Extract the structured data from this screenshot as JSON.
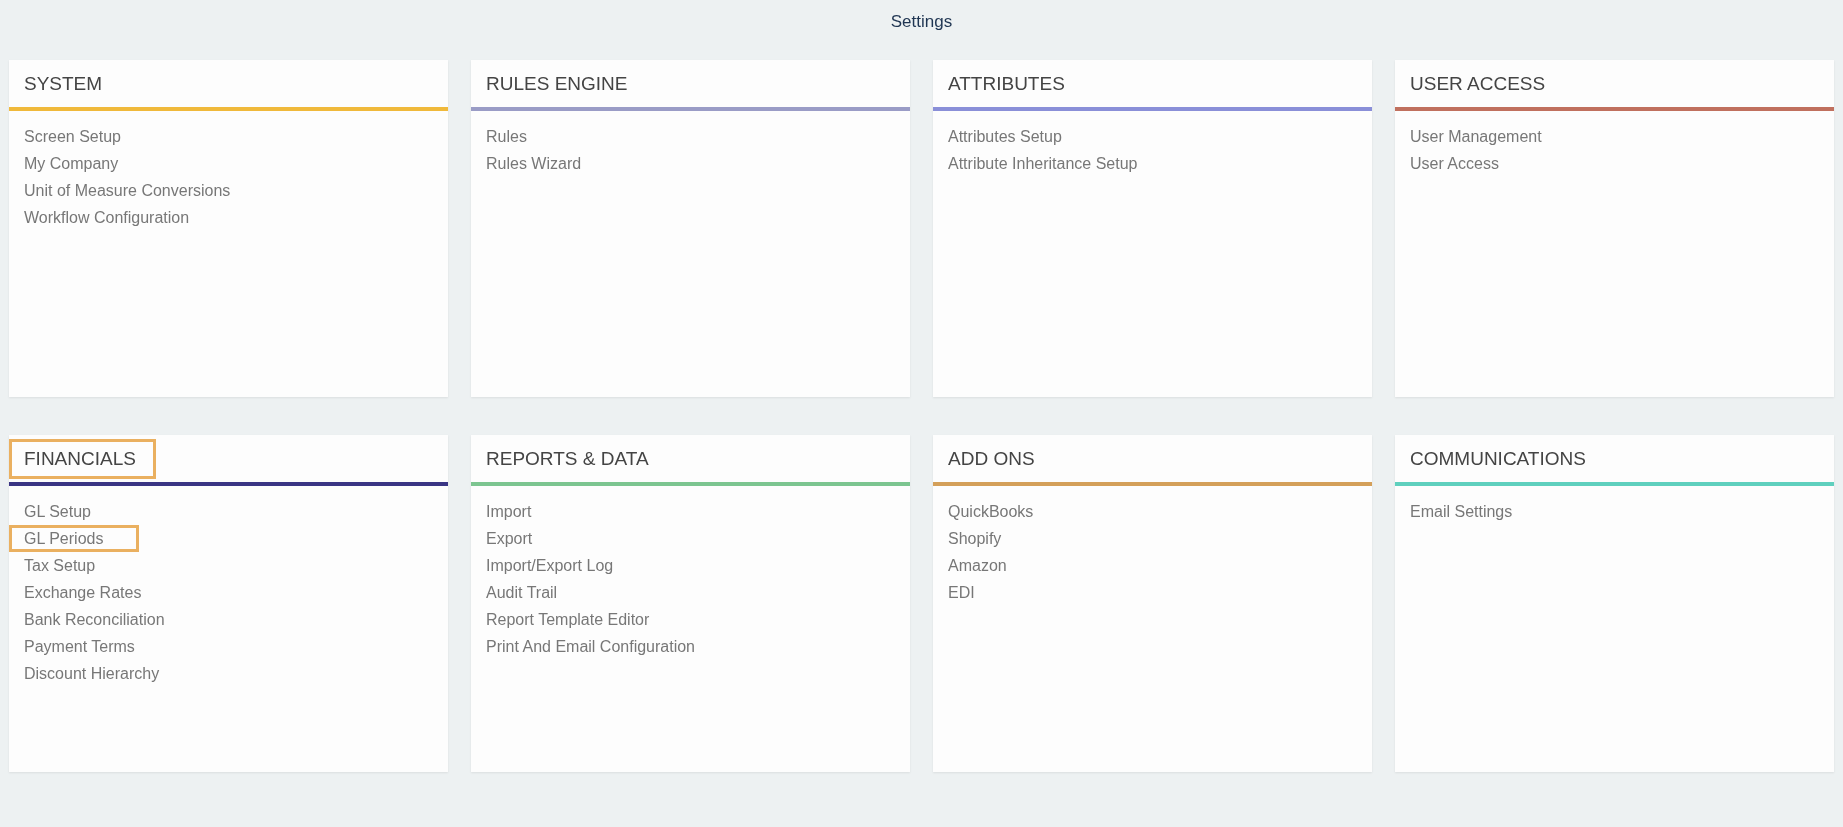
{
  "page": {
    "title": "Settings"
  },
  "sections": [
    {
      "title": "SYSTEM",
      "color": "#f0b93b",
      "highlighted": false,
      "items": [
        {
          "label": "Screen Setup",
          "highlighted": false
        },
        {
          "label": "My Company",
          "highlighted": false
        },
        {
          "label": "Unit of Measure Conversions",
          "highlighted": false
        },
        {
          "label": "Workflow Configuration",
          "highlighted": false
        }
      ]
    },
    {
      "title": "RULES ENGINE",
      "color": "#9a9cc6",
      "highlighted": false,
      "items": [
        {
          "label": "Rules",
          "highlighted": false
        },
        {
          "label": "Rules Wizard",
          "highlighted": false
        }
      ]
    },
    {
      "title": "ATTRIBUTES",
      "color": "#8a8fd8",
      "highlighted": false,
      "items": [
        {
          "label": "Attributes Setup",
          "highlighted": false
        },
        {
          "label": "Attribute Inheritance Setup",
          "highlighted": false
        }
      ]
    },
    {
      "title": "USER ACCESS",
      "color": "#c0705e",
      "highlighted": false,
      "items": [
        {
          "label": "User Management",
          "highlighted": false
        },
        {
          "label": "User Access",
          "highlighted": false
        }
      ]
    },
    {
      "title": "FINANCIALS",
      "color": "#3a3584",
      "highlighted": true,
      "items": [
        {
          "label": "GL Setup",
          "highlighted": false
        },
        {
          "label": "GL Periods",
          "highlighted": true
        },
        {
          "label": "Tax Setup",
          "highlighted": false
        },
        {
          "label": "Exchange Rates",
          "highlighted": false
        },
        {
          "label": "Bank Reconciliation",
          "highlighted": false
        },
        {
          "label": "Payment Terms",
          "highlighted": false
        },
        {
          "label": "Discount Hierarchy",
          "highlighted": false
        }
      ]
    },
    {
      "title": "REPORTS & DATA",
      "color": "#7cc590",
      "highlighted": false,
      "items": [
        {
          "label": "Import",
          "highlighted": false
        },
        {
          "label": "Export",
          "highlighted": false
        },
        {
          "label": "Import/Export Log",
          "highlighted": false
        },
        {
          "label": "Audit Trail",
          "highlighted": false
        },
        {
          "label": "Report Template Editor",
          "highlighted": false
        },
        {
          "label": "Print And Email Configuration",
          "highlighted": false
        }
      ]
    },
    {
      "title": "ADD ONS",
      "color": "#d4a05a",
      "highlighted": false,
      "items": [
        {
          "label": "QuickBooks",
          "highlighted": false
        },
        {
          "label": "Shopify",
          "highlighted": false
        },
        {
          "label": "Amazon",
          "highlighted": false
        },
        {
          "label": "EDI",
          "highlighted": false
        }
      ]
    },
    {
      "title": "COMMUNICATIONS",
      "color": "#5fd0be",
      "highlighted": false,
      "items": [
        {
          "label": "Email Settings",
          "highlighted": false
        }
      ]
    }
  ]
}
